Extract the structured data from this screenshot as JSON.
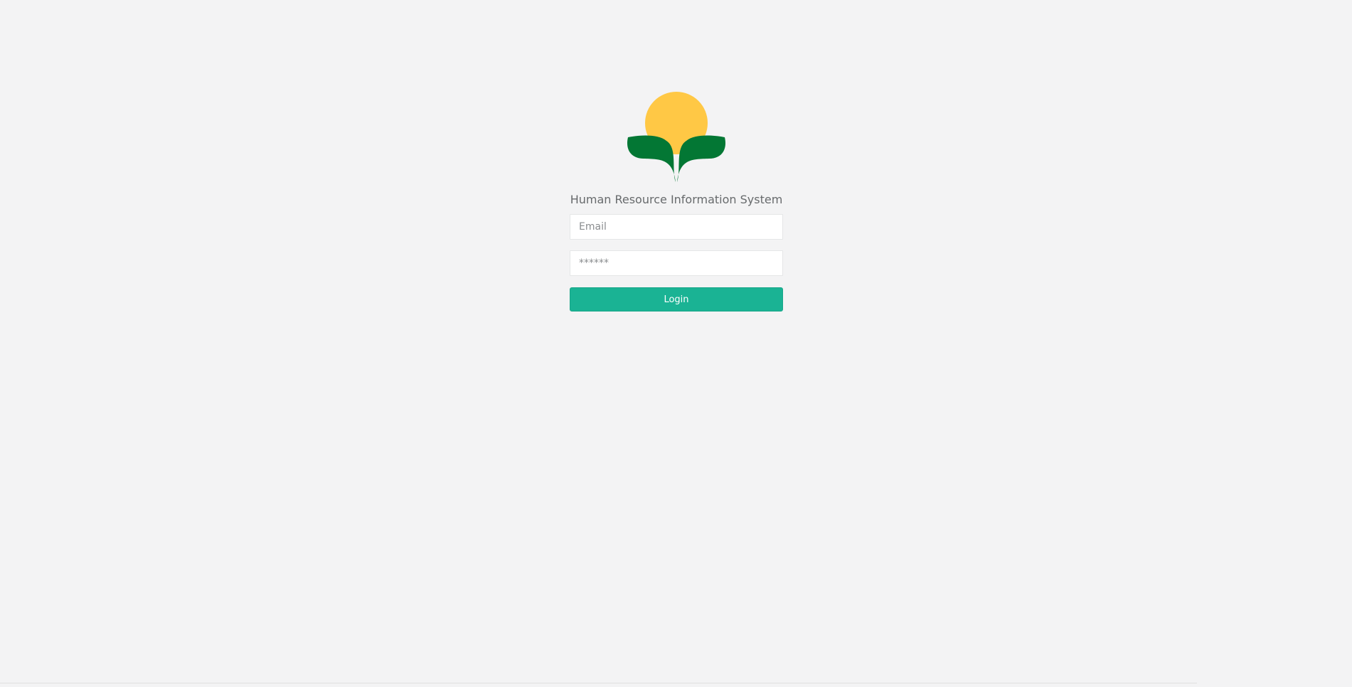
{
  "app": {
    "title": "Human Resource Information System"
  },
  "logo": {
    "sun_color": "#ffc845",
    "leaf_color": "#037734"
  },
  "login_form": {
    "email_placeholder": "Email",
    "password_placeholder": "******",
    "login_label": "Login"
  },
  "colors": {
    "background": "#f3f3f4",
    "accent": "#1ab394"
  }
}
